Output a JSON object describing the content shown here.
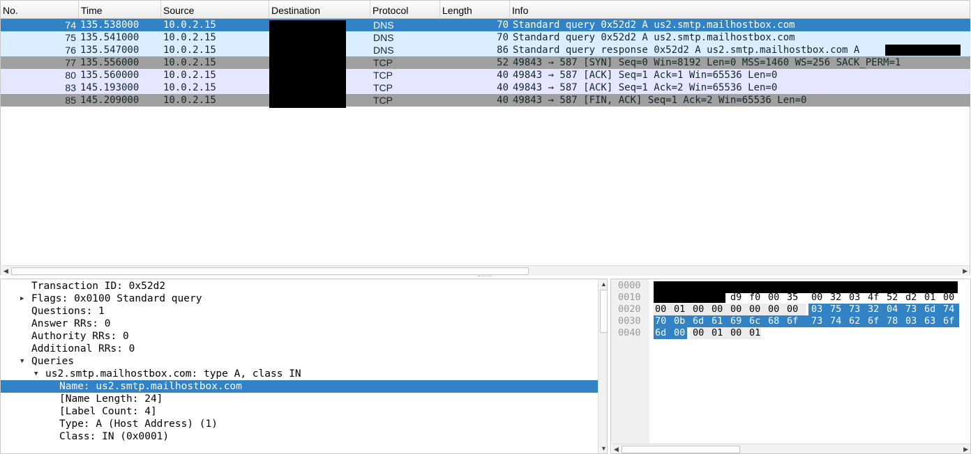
{
  "packet_list": {
    "columns": [
      "No.",
      "Time",
      "Source",
      "Destination",
      "Protocol",
      "Length",
      "Info"
    ],
    "rows": [
      {
        "no": "74",
        "time": "135.538000",
        "source": "10.0.2.15",
        "protocol": "DNS",
        "length": "70",
        "info": "Standard query 0x52d2 A us2.smtp.mailhostbox.com",
        "bg": "#3282c6",
        "fg": "#ffffff"
      },
      {
        "no": "75",
        "time": "135.541000",
        "source": "10.0.2.15",
        "protocol": "DNS",
        "length": "70",
        "info": "Standard query 0x52d2 A us2.smtp.mailhostbox.com",
        "bg": "#daeeff",
        "fg": "#12272e"
      },
      {
        "no": "76",
        "time": "135.547000",
        "source": "10.0.2.15",
        "protocol": "DNS",
        "length": "86",
        "info": "Standard query response 0x52d2 A us2.smtp.mailhostbox.com A",
        "bg": "#daeeff",
        "fg": "#12272e"
      },
      {
        "no": "77",
        "time": "135.556000",
        "source": "10.0.2.15",
        "protocol": "TCP",
        "length": "52",
        "info": "49843 → 587 [SYN] Seq=0 Win=8192 Len=0 MSS=1460 WS=256 SACK_PERM=1",
        "bg": "#a0a0a0",
        "fg": "#12272e"
      },
      {
        "no": "80",
        "time": "135.560000",
        "source": "10.0.2.15",
        "protocol": "TCP",
        "length": "40",
        "info": "49843 → 587 [ACK] Seq=1 Ack=1 Win=65536 Len=0",
        "bg": "#e7e6ff",
        "fg": "#12272e"
      },
      {
        "no": "83",
        "time": "145.193000",
        "source": "10.0.2.15",
        "protocol": "TCP",
        "length": "40",
        "info": "49843 → 587 [ACK] Seq=1 Ack=2 Win=65536 Len=0",
        "bg": "#e7e6ff",
        "fg": "#12272e"
      },
      {
        "no": "85",
        "time": "145.209000",
        "source": "10.0.2.15",
        "protocol": "TCP",
        "length": "40",
        "info": "49843 → 587 [FIN, ACK] Seq=1 Ack=2 Win=65536 Len=0",
        "bg": "#a0a0a0",
        "fg": "#12272e"
      }
    ]
  },
  "details": {
    "lines": [
      {
        "text": "Transaction ID: 0x52d2",
        "indent": 0,
        "twist": ""
      },
      {
        "text": "Flags: 0x0100 Standard query",
        "indent": 0,
        "twist": "collapsed"
      },
      {
        "text": "Questions: 1",
        "indent": 0,
        "twist": ""
      },
      {
        "text": "Answer RRs: 0",
        "indent": 0,
        "twist": ""
      },
      {
        "text": "Authority RRs: 0",
        "indent": 0,
        "twist": ""
      },
      {
        "text": "Additional RRs: 0",
        "indent": 0,
        "twist": ""
      },
      {
        "text": "Queries",
        "indent": 0,
        "twist": "expanded"
      },
      {
        "text": "us2.smtp.mailhostbox.com: type A, class IN",
        "indent": 1,
        "twist": "expanded"
      },
      {
        "text": "Name: us2.smtp.mailhostbox.com",
        "indent": 2,
        "twist": "",
        "selected": true
      },
      {
        "text": "[Name Length: 24]",
        "indent": 2,
        "twist": ""
      },
      {
        "text": "[Label Count: 4]",
        "indent": 2,
        "twist": ""
      },
      {
        "text": "Type: A (Host Address) (1)",
        "indent": 2,
        "twist": ""
      },
      {
        "text": "Class: IN (0x0001)",
        "indent": 2,
        "twist": ""
      }
    ]
  },
  "bytes": {
    "offsets": [
      "0000",
      "0010",
      "0020",
      "0030",
      "0040"
    ],
    "rows": [
      [],
      [
        "",
        "",
        "",
        "",
        "d9",
        "f0",
        "00",
        "35",
        "00",
        "32",
        "03",
        "4f",
        "52",
        "d2",
        "01",
        "00"
      ],
      [
        "00",
        "01",
        "00",
        "00",
        "00",
        "00",
        "00",
        "00",
        "03",
        "75",
        "73",
        "32",
        "04",
        "73",
        "6d",
        "74"
      ],
      [
        "70",
        "0b",
        "6d",
        "61",
        "69",
        "6c",
        "68",
        "6f",
        "73",
        "74",
        "62",
        "6f",
        "78",
        "03",
        "63",
        "6f"
      ],
      [
        "6d",
        "00",
        "00",
        "01",
        "00",
        "01"
      ]
    ]
  },
  "colors": {
    "selection": "#3282c6",
    "dns_row": "#daeeff",
    "tcp_row": "#e7e6ff",
    "tcp_flag_row": "#a0a0a0"
  }
}
